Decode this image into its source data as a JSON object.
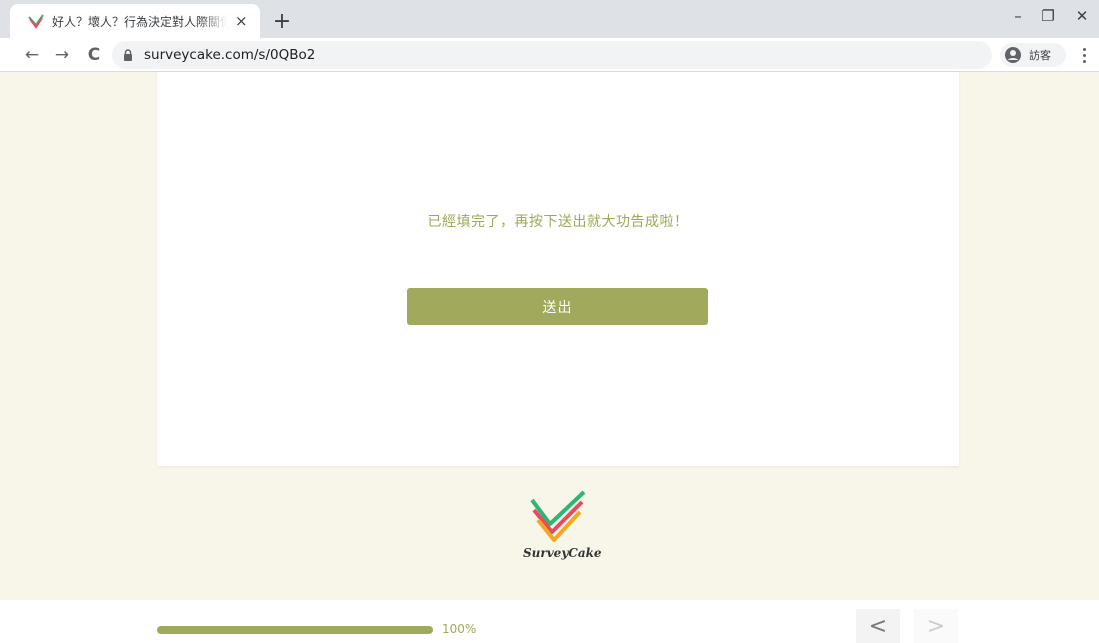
{
  "browser": {
    "tab_title": "好人？壞人？行為決定對人際關係",
    "tab_close": "×",
    "new_tab": "+",
    "url": "surveycake.com/s/0QBo2",
    "profile_label": "訪客",
    "window_controls": {
      "minimize": "–",
      "restore": "❐",
      "close": "✕"
    },
    "nav": {
      "back": "←",
      "forward": "→",
      "reload": "C"
    }
  },
  "page": {
    "message": "已經填完了，再按下送出就大功告成啦！",
    "submit_label": "送出",
    "logo_text": "SurveyCake"
  },
  "footer": {
    "progress_value": 100,
    "progress_label": "100%",
    "prev": "<",
    "next": ">"
  },
  "colors": {
    "accent": "#a0a95c",
    "message": "#9aaa55",
    "background": "#f8f6e9"
  },
  "icons": {
    "favicon": "surveycake-favicon",
    "lock": "lock-icon",
    "profile": "account-circle-icon",
    "menu": "more-vert-icon"
  }
}
